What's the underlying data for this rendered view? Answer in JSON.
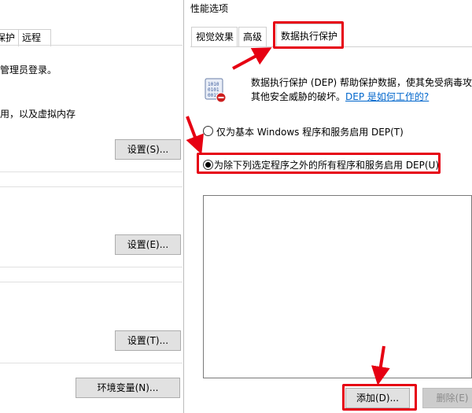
{
  "left_dialog": {
    "tabs": [
      "保护",
      "远程"
    ],
    "admin_text": "管理员登录。",
    "perf_text": "用，以及虚拟内存",
    "buttons": {
      "settings_s": "设置(S)...",
      "settings_e": "设置(E)...",
      "settings_t": "设置(T)...",
      "env_vars": "环境变量(N)..."
    }
  },
  "right_dialog": {
    "title": "性能选项",
    "tabs": [
      {
        "label": "视觉效果"
      },
      {
        "label": "高级"
      },
      {
        "label": "数据执行保护"
      }
    ],
    "description_line1": "数据执行保护 (DEP) 帮助保护数据，使其免受病毒攻",
    "description_line2": "其他安全威胁的破坏。",
    "description_link": "DEP 是如何工作的?",
    "radio_option1": "仅为基本 Windows 程序和服务启用 DEP(T)",
    "radio_option2": "为除下列选定程序之外的所有程序和服务启用 DEP(U)",
    "buttons": {
      "add": "添加(D)...",
      "remove": "删除(E)"
    }
  },
  "colors": {
    "annotation_red": "#e60012",
    "link_blue": "#0066cc"
  }
}
